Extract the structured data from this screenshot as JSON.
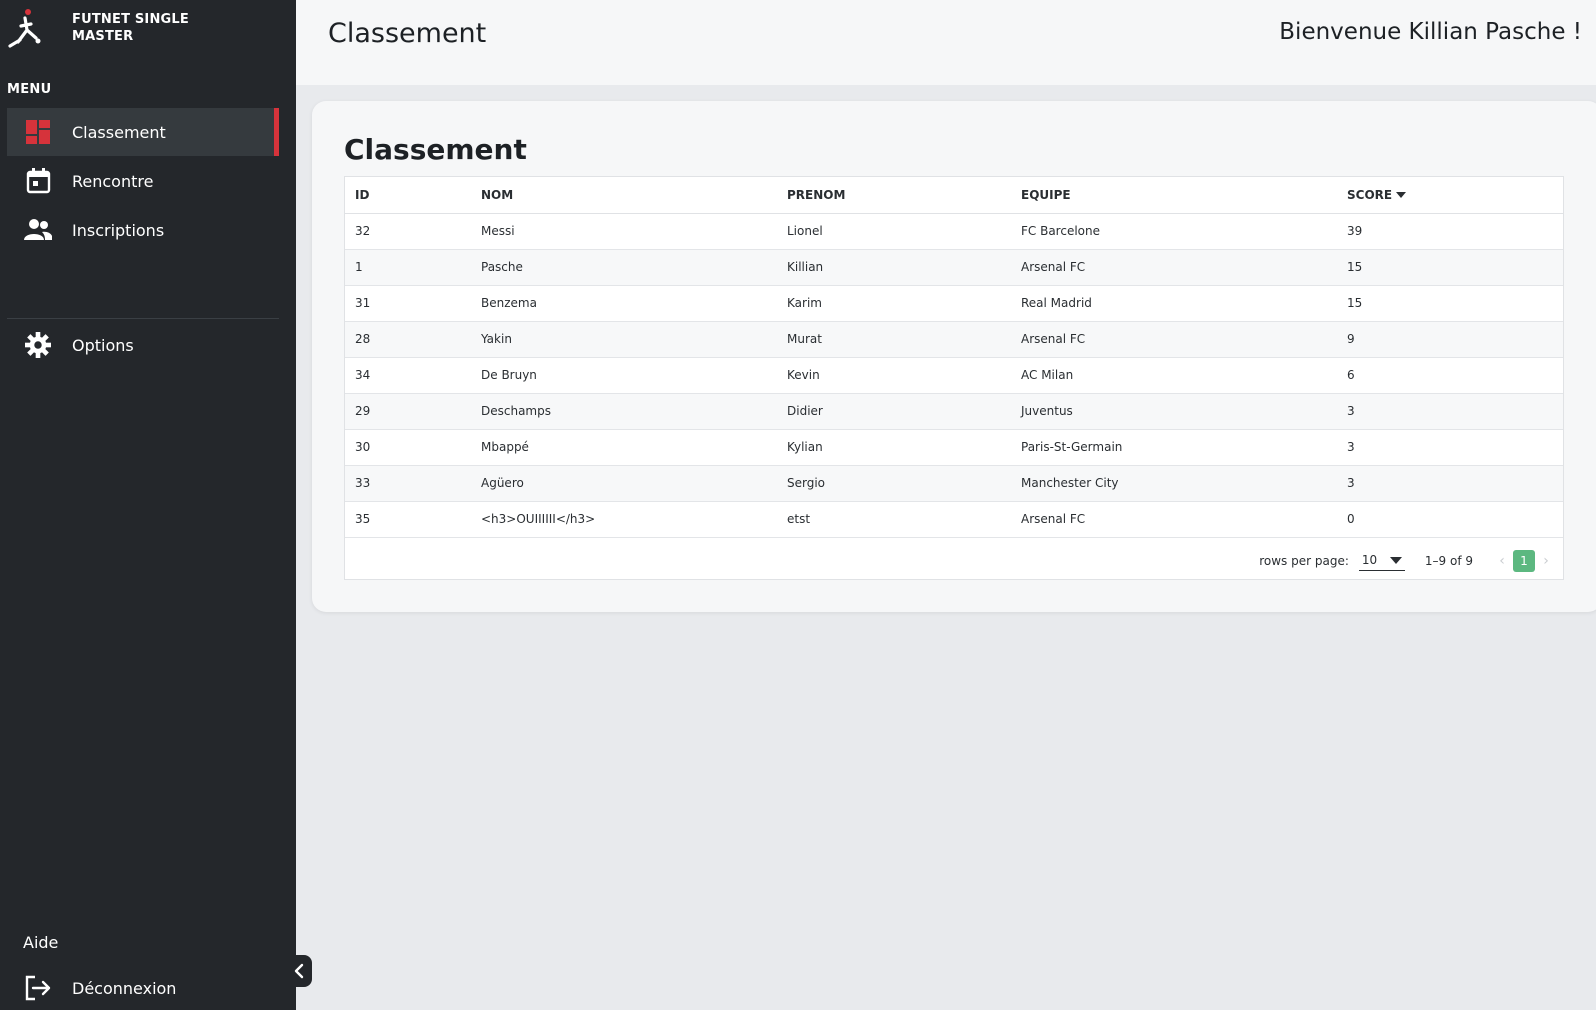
{
  "app": {
    "brand": "FUTNET SINGLE MASTER"
  },
  "sidebar": {
    "menu_heading": "MENU",
    "items": [
      {
        "label": "Classement",
        "icon": "dashboard-icon"
      },
      {
        "label": "Rencontre",
        "icon": "calendar-icon"
      },
      {
        "label": "Inscriptions",
        "icon": "people-icon"
      },
      {
        "label": "Options",
        "icon": "gear-icon"
      }
    ],
    "help": "Aide",
    "logout": "Déconnexion"
  },
  "header": {
    "title": "Classement",
    "welcome": "Bienvenue Killian Pasche !"
  },
  "card": {
    "title": "Classement"
  },
  "table": {
    "columns": [
      "ID",
      "NOM",
      "PRENOM",
      "EQUIPE",
      "SCORE"
    ],
    "rows": [
      [
        "32",
        "Messi",
        "Lionel",
        "FC Barcelone",
        "39"
      ],
      [
        "1",
        "Pasche",
        "Killian",
        "Arsenal FC",
        "15"
      ],
      [
        "31",
        "Benzema",
        "Karim",
        "Real Madrid",
        "15"
      ],
      [
        "28",
        "Yakin",
        "Murat",
        "Arsenal FC",
        "9"
      ],
      [
        "34",
        "De Bruyn",
        "Kevin",
        "AC Milan",
        "6"
      ],
      [
        "29",
        "Deschamps",
        "Didier",
        "Juventus",
        "3"
      ],
      [
        "30",
        "Mbappé",
        "Kylian",
        "Paris-St-Germain",
        "3"
      ],
      [
        "33",
        "Agüero",
        "Sergio",
        "Manchester City",
        "3"
      ],
      [
        "35",
        "<h3>OUIIIIII</h3>",
        "etst",
        "Arsenal FC",
        "0"
      ]
    ]
  },
  "pager": {
    "rows_label": "rows per page:",
    "rows_value": "10",
    "range": "1–9 of 9",
    "current_page": "1",
    "prev": "‹",
    "next": "›"
  },
  "colors": {
    "sidebar_bg": "#24272b",
    "accent_red": "#d6333b",
    "page_green": "#5cb880"
  }
}
